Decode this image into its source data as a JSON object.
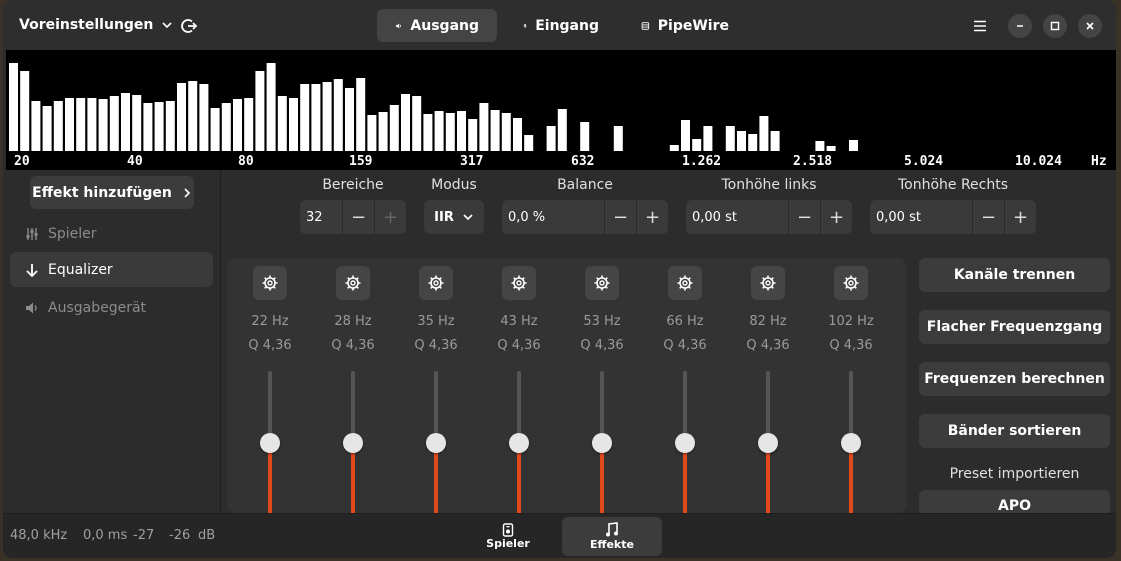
{
  "header": {
    "presets_label": "Voreinstellungen",
    "tabs": [
      {
        "label": "Ausgang",
        "icon": "speaker-icon"
      },
      {
        "label": "Eingang",
        "icon": "microphone-icon"
      },
      {
        "label": "PipeWire",
        "icon": "pipewire-icon"
      }
    ]
  },
  "spectrum": {
    "labels": [
      "20",
      "40",
      "80",
      "159",
      "317",
      "632",
      "1.262",
      "2.518",
      "5.024",
      "10.024",
      "Hz"
    ],
    "bar_levels": [
      0.88,
      0.8,
      0.5,
      0.45,
      0.5,
      0.53,
      0.53,
      0.53,
      0.52,
      0.55,
      0.58,
      0.56,
      0.48,
      0.49,
      0.5,
      0.68,
      0.7,
      0.67,
      0.43,
      0.48,
      0.52,
      0.53,
      0.8,
      0.88,
      0.55,
      0.53,
      0.67,
      0.67,
      0.69,
      0.72,
      0.63,
      0.73,
      0.36,
      0.39,
      0.46,
      0.57,
      0.55,
      0.37,
      0.4,
      0.38,
      0.4,
      0.32,
      0.48,
      0.41,
      0.38,
      0.33,
      0.16,
      0,
      0.25,
      0.42,
      0,
      0.29,
      0,
      0,
      0.25,
      0,
      0,
      0,
      0,
      0.06,
      0.31,
      0.12,
      0.25,
      0,
      0.25,
      0.2,
      0.17,
      0.35,
      0.2,
      0,
      0,
      0,
      0.1,
      0.05,
      0,
      0.11
    ]
  },
  "sidebar": {
    "add_effect": "Effekt hinzufügen",
    "items": [
      {
        "label": "Spieler"
      },
      {
        "label": "Equalizer"
      },
      {
        "label": "Ausgabegerät"
      }
    ]
  },
  "controls": {
    "bands_label": "Bereiche",
    "bands_value": "32",
    "mode_label": "Modus",
    "mode_value": "IIR",
    "balance_label": "Balance",
    "balance_value": "0,0 %",
    "pitch_left_label": "Tonhöhe links",
    "pitch_left_value": "0,00 st",
    "pitch_right_label": "Tonhöhe Rechts",
    "pitch_right_value": "0,00 st",
    "minus": "−",
    "plus": "+"
  },
  "equalizer": {
    "bands": [
      {
        "freq": "22 Hz",
        "q": "Q 4,36",
        "level": 0.3
      },
      {
        "freq": "28 Hz",
        "q": "Q 4,36",
        "level": 0.3
      },
      {
        "freq": "35 Hz",
        "q": "Q 4,36",
        "level": 0.3
      },
      {
        "freq": "43 Hz",
        "q": "Q 4,36",
        "level": 0.3
      },
      {
        "freq": "53 Hz",
        "q": "Q 4,36",
        "level": 0.3
      },
      {
        "freq": "66 Hz",
        "q": "Q 4,36",
        "level": 0.3
      },
      {
        "freq": "82 Hz",
        "q": "Q 4,36",
        "level": 0.3
      },
      {
        "freq": "102 Hz",
        "q": "Q 4,36",
        "level": 0.3
      }
    ]
  },
  "actions": {
    "split_channels": "Kanäle trennen",
    "flat_response": "Flacher Frequenzgang",
    "calc_frequencies": "Frequenzen berechnen",
    "sort_bands": "Bänder sortieren",
    "import_preset_label": "Preset importieren",
    "apo": "APO"
  },
  "status": {
    "rate": "48,0 kHz",
    "latency": "0,0 ms",
    "level_left": "-27",
    "level_right": "-26",
    "unit": "dB"
  },
  "bottom_tabs": [
    {
      "label": "Spieler",
      "icon": "player-icon"
    },
    {
      "label": "Effekte",
      "icon": "music-note-icon"
    }
  ],
  "colors": {
    "accent": "#e0491b",
    "window_bg": "#2c2c2c",
    "button_bg": "#3c3c3c"
  }
}
